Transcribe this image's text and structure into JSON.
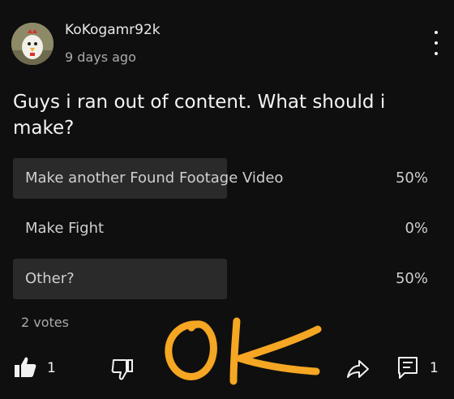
{
  "post": {
    "author": "KoKogamr92k",
    "time": "9 days ago",
    "text": "Guys i ran out of content. What should i make?",
    "menu_icon": "more-vert-icon"
  },
  "poll": {
    "options": [
      {
        "label": "Make another Found Footage Video",
        "percent": "50%",
        "fraction": 0.5
      },
      {
        "label": "Make Fight",
        "percent": "0%",
        "fraction": 0
      },
      {
        "label": "Other?",
        "percent": "50%",
        "fraction": 0.5
      }
    ],
    "votes": "2 votes"
  },
  "actions": {
    "like_icon": "thumbs-up-icon",
    "like_count": "1",
    "dislike_icon": "thumbs-down-icon",
    "share_icon": "share-icon",
    "comment_icon": "comment-icon",
    "comment_count": "1"
  },
  "overlay": {
    "handwritten_text": "OK",
    "color": "#f5a623"
  },
  "colors": {
    "background": "#0f0f0f",
    "poll_bar": "#2a2a2a"
  }
}
